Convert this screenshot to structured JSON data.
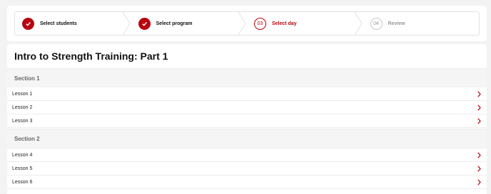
{
  "stepper": {
    "steps": [
      {
        "label": "Select students",
        "state": "done"
      },
      {
        "label": "Select program",
        "state": "done"
      },
      {
        "number": "03",
        "label": "Select day",
        "state": "active"
      },
      {
        "number": "04",
        "label": "Review",
        "state": "todo"
      }
    ]
  },
  "program": {
    "title": "Intro to Strength Training: Part 1",
    "sections": [
      {
        "title": "Section 1",
        "lessons": [
          "Lesson 1",
          "Lesson 2",
          "Lesson 3"
        ]
      },
      {
        "title": "Section 2",
        "lessons": [
          "Lesson 4",
          "Lesson 5",
          "Lesson 6"
        ]
      }
    ]
  },
  "icons": {
    "check": "checkmark-icon",
    "arrow": "chevron-right-icon"
  },
  "colors": {
    "accent": "#b8040f",
    "muted": "#999999",
    "section_bg": "#f5f5f5"
  }
}
